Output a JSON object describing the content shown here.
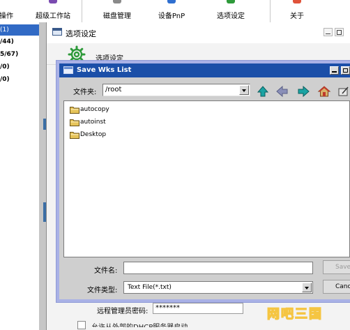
{
  "toolbar": {
    "items": [
      {
        "label": "操作"
      },
      {
        "label": "超级工作站"
      },
      {
        "label": "磁盘管理"
      },
      {
        "label": "设备PnP"
      },
      {
        "label": "选项设定"
      },
      {
        "label": "关于"
      }
    ]
  },
  "left_tree": {
    "rows": [
      {
        "text": "(1)",
        "selected": true
      },
      {
        "text": "/44)",
        "selected": false
      },
      {
        "text": "5/67)",
        "selected": false
      },
      {
        "text": "/0)",
        "selected": false
      },
      {
        "text": "/0)",
        "selected": false
      }
    ]
  },
  "options_dialog": {
    "title": "选项设定",
    "heading": "选项设定",
    "icon": "gear-icon",
    "remote_admin_password_label": "远程管理员密码:",
    "remote_admin_password_value": "*******",
    "dhcp_checkbox_label": "允许从外部的DHCP服务器启动"
  },
  "save_dialog": {
    "title": "Save Wks List",
    "look_in_label": "文件夹:",
    "look_in_value": "/root",
    "nav_icons": [
      "up-arrow-icon",
      "back-arrow-icon",
      "forward-arrow-icon",
      "home-icon",
      "new-folder-icon"
    ],
    "files": [
      {
        "name": "autocopy",
        "icon": "folder-icon"
      },
      {
        "name": "autoinst",
        "icon": "folder-icon"
      },
      {
        "name": "Desktop",
        "icon": "folder-icon"
      }
    ],
    "filename_label": "文件名:",
    "filename_value": "",
    "filetype_label": "文件类型:",
    "filetype_value": "Text File(*.txt)",
    "save_button": "Save",
    "cancel_button": "Cancel"
  },
  "watermark": {
    "text": "网吧三国"
  },
  "colors": {
    "titlebar": "#1b4fa8",
    "selection": "#316ac5",
    "dialog_border": "#a9b1e6",
    "watermark": "#f5c542"
  }
}
